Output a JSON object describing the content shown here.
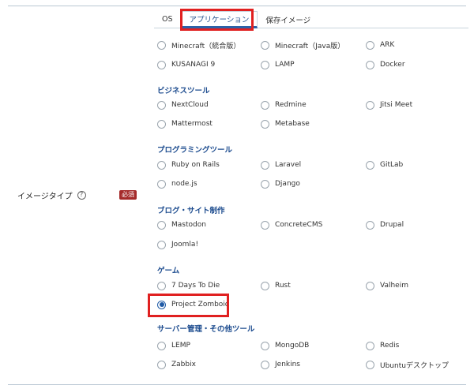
{
  "field": {
    "label": "イメージタイプ",
    "help_icon": "?",
    "required_badge": "必須",
    "help_icon_name": "question-circle-icon"
  },
  "tabs": [
    {
      "label": "OS",
      "active": false
    },
    {
      "label": "アプリケーション",
      "active": true
    },
    {
      "label": "保存イメージ",
      "active": false
    }
  ],
  "general": [
    "Minecraft（統合版）",
    "Minecraft（Java版）",
    "ARK",
    "KUSANAGI 9",
    "LAMP",
    "Docker"
  ],
  "sections": [
    {
      "title": "ビジネスツール",
      "options": [
        "NextCloud",
        "Redmine",
        "Jitsi Meet",
        "Mattermost",
        "Metabase"
      ]
    },
    {
      "title": "プログラミングツール",
      "options": [
        "Ruby on Rails",
        "Laravel",
        "GitLab",
        "node.js",
        "Django"
      ]
    },
    {
      "title": "ブログ・サイト制作",
      "options": [
        "Mastodon",
        "ConcreteCMS",
        "Drupal",
        "Joomla!"
      ]
    },
    {
      "title": "ゲーム",
      "options": [
        "7 Days To Die",
        "Rust",
        "Valheim",
        "Project Zomboid"
      ]
    },
    {
      "title": "サーバー管理・その他ツール",
      "options": [
        "LEMP",
        "MongoDB",
        "Redis",
        "Zabbix",
        "Jenkins",
        "Ubuntuデスクトップ"
      ]
    }
  ],
  "selected": "Project Zomboid",
  "colors": {
    "accent": "#1f5aa6",
    "section_title": "#1d4c8f",
    "required_badge": "#a52a2a",
    "highlight": "#e02020"
  }
}
